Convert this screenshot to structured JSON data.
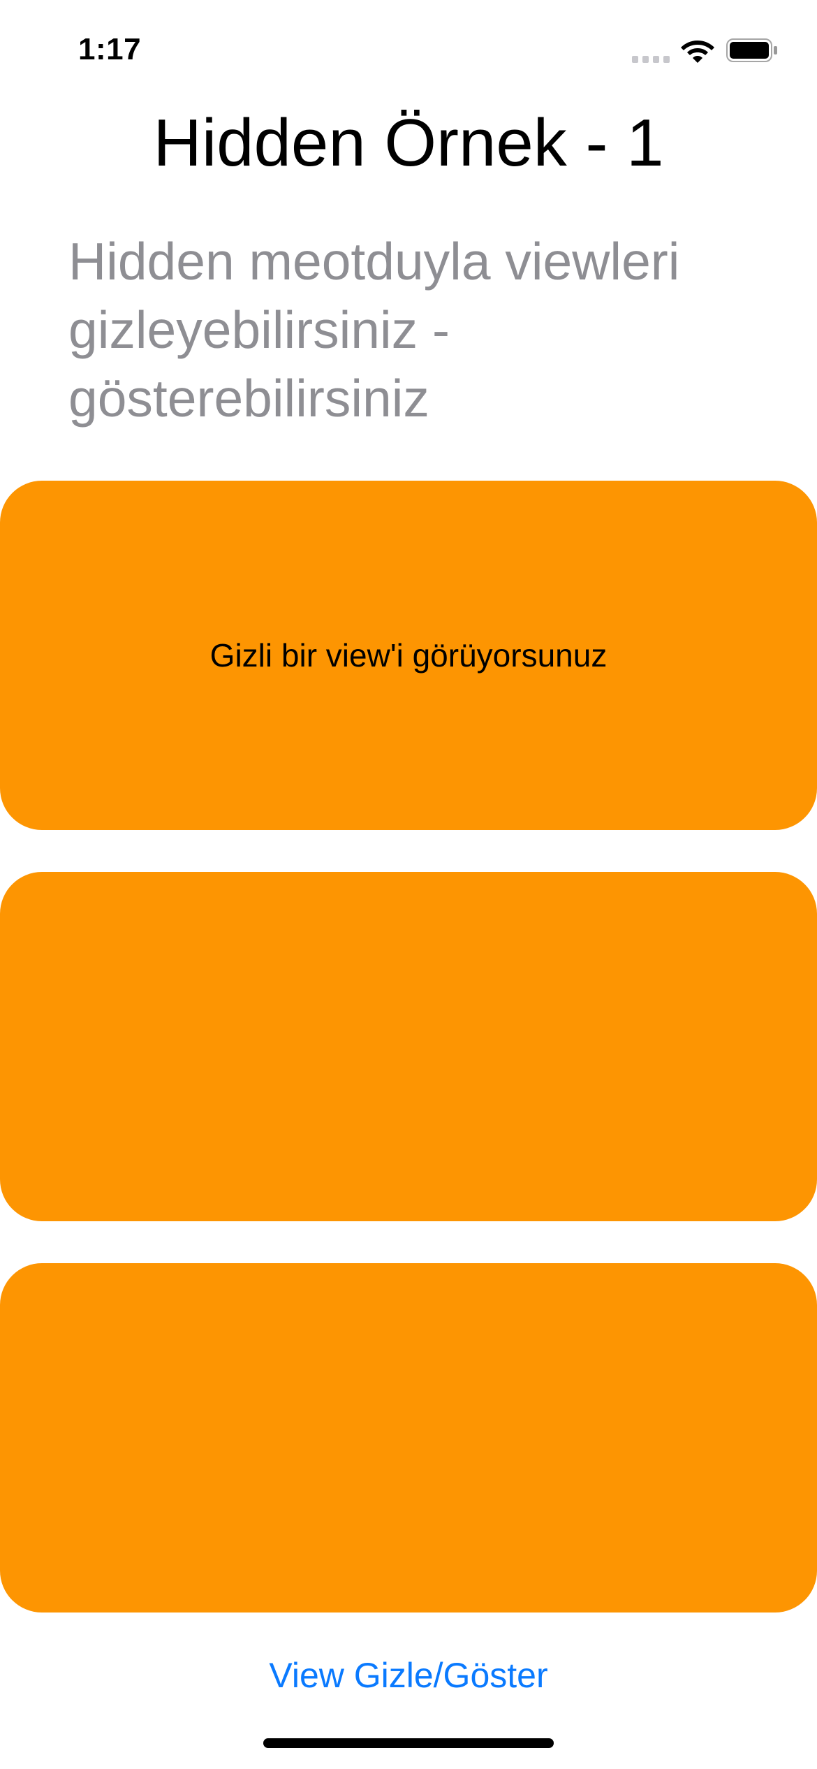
{
  "status_bar": {
    "time": "1:17",
    "icons": [
      "signal-icon",
      "wifi-icon",
      "battery-icon"
    ]
  },
  "title": "Hidden Örnek - 1",
  "subtitle": "Hidden meotduyla viewleri gizleyebilirsiniz - gösterebilirsiniz",
  "cards": [
    {
      "label": "Gizli bir view'i görüyorsunuz"
    },
    {
      "label": ""
    },
    {
      "label": ""
    }
  ],
  "toggle_button": {
    "label": "View Gizle/Göster"
  },
  "colors": {
    "card_background": "#fd9502",
    "button_text": "#0a7aff",
    "subtitle_text": "#8e8e93",
    "background": "#ffffff"
  }
}
